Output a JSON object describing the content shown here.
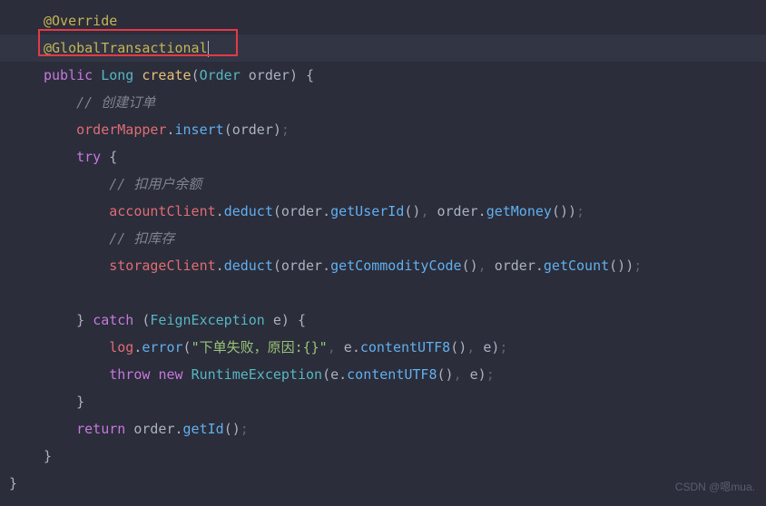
{
  "code": {
    "l1_annotation": "@Override",
    "l2_annotation": "@GlobalTransactional",
    "l3_public": "public ",
    "l3_type": "Long ",
    "l3_method": "create",
    "l3_paren_open": "(",
    "l3_param_type": "Order ",
    "l3_param_name": "order",
    "l3_paren_close": ") ",
    "l3_brace": "{",
    "l4_comment": "// 创建订单",
    "l5_obj": "orderMapper",
    "l5_dot": ".",
    "l5_method": "insert",
    "l5_args": "(order)",
    "l5_semi": ";",
    "l6_try": "try ",
    "l6_brace": "{",
    "l7_comment": "// 扣用户余额",
    "l8_obj": "accountClient",
    "l8_dot1": ".",
    "l8_method": "deduct",
    "l8_open": "(",
    "l8_arg1": "order",
    "l8_dot2": ".",
    "l8_get1": "getUserId",
    "l8_par1": "()",
    "l8_comma": ", ",
    "l8_arg2": "order",
    "l8_dot3": ".",
    "l8_get2": "getMoney",
    "l8_par2": "()",
    "l8_close": ")",
    "l8_semi": ";",
    "l9_comment": "// 扣库存",
    "l10_obj": "storageClient",
    "l10_dot1": ".",
    "l10_method": "deduct",
    "l10_open": "(",
    "l10_arg1": "order",
    "l10_dot2": ".",
    "l10_get1": "getCommodityCode",
    "l10_par1": "()",
    "l10_comma": ", ",
    "l10_arg2": "order",
    "l10_dot3": ".",
    "l10_get2": "getCount",
    "l10_par2": "()",
    "l10_close": ")",
    "l10_semi": ";",
    "l12_brace": "} ",
    "l12_catch": "catch ",
    "l12_open": "(",
    "l12_type": "FeignException ",
    "l12_var": "e",
    "l12_close": ") ",
    "l12_brace2": "{",
    "l13_obj": "log",
    "l13_dot": ".",
    "l13_method": "error",
    "l13_open": "(",
    "l13_str": "\"下单失败，原因:{}\"",
    "l13_comma1": ", ",
    "l13_arg1": "e",
    "l13_dot2": ".",
    "l13_method2": "contentUTF8",
    "l13_par": "()",
    "l13_comma2": ", ",
    "l13_arg2": "e",
    "l13_close": ")",
    "l13_semi": ";",
    "l14_throw": "throw ",
    "l14_new": "new ",
    "l14_type": "RuntimeException",
    "l14_open": "(",
    "l14_arg1": "e",
    "l14_dot": ".",
    "l14_method": "contentUTF8",
    "l14_par": "()",
    "l14_comma": ", ",
    "l14_arg2": "e",
    "l14_close": ")",
    "l14_semi": ";",
    "l15_brace": "}",
    "l16_return": "return ",
    "l16_obj": "order",
    "l16_dot": ".",
    "l16_method": "getId",
    "l16_par": "()",
    "l16_semi": ";",
    "l17_brace": "}",
    "l18_brace": "}"
  },
  "watermark": "CSDN @嗯mua."
}
